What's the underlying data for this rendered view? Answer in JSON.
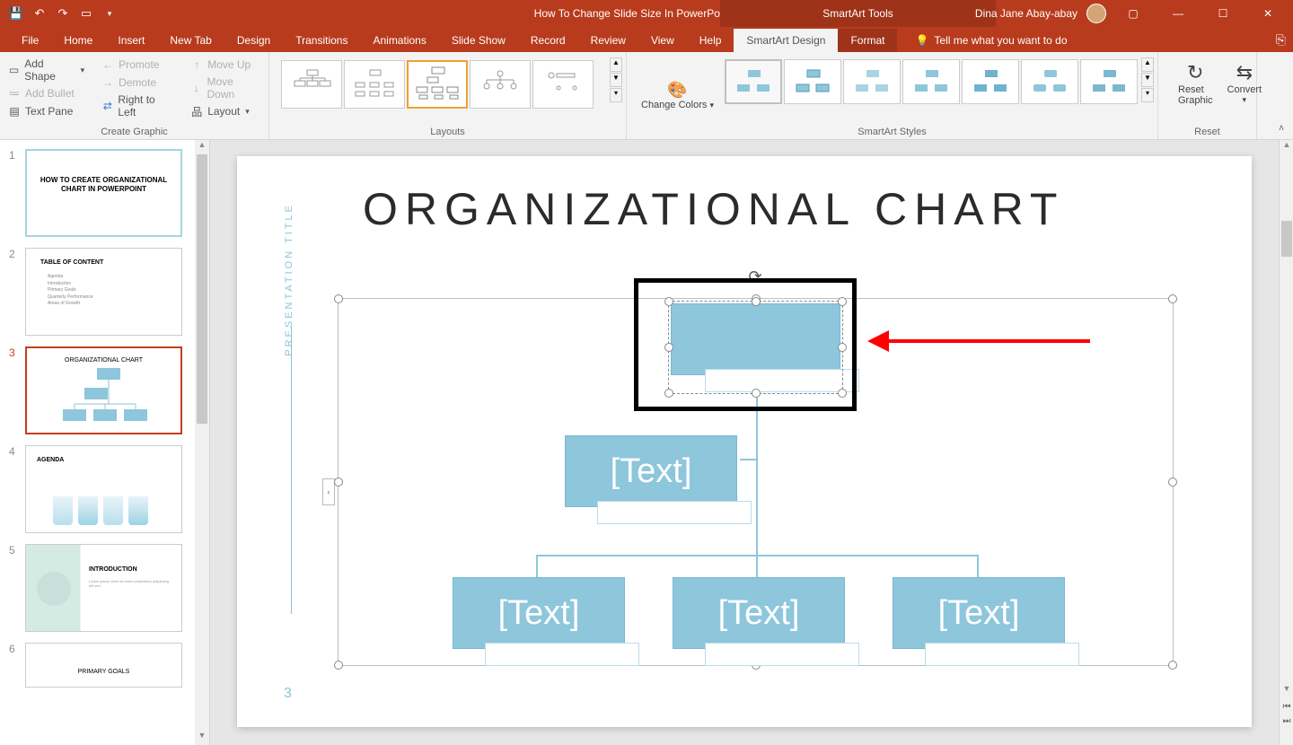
{
  "titlebar": {
    "doc_title": "How To Change Slide Size In PowerPoint.pptx [Autosaved]  -  PowerPoint",
    "tools_label": "SmartArt Tools",
    "user_name": "Dina Jane Abay-abay"
  },
  "tabs": {
    "file": "File",
    "home": "Home",
    "insert": "Insert",
    "newtab": "New Tab",
    "design": "Design",
    "transitions": "Transitions",
    "animations": "Animations",
    "slideshow": "Slide Show",
    "record": "Record",
    "review": "Review",
    "view": "View",
    "help": "Help",
    "smartart_design": "SmartArt Design",
    "format": "Format",
    "tell_me": "Tell me what you want to do"
  },
  "ribbon": {
    "create_graphic": {
      "add_shape": "Add Shape",
      "add_bullet": "Add Bullet",
      "text_pane": "Text Pane",
      "promote": "Promote",
      "demote": "Demote",
      "right_to_left": "Right to Left",
      "move_up": "Move Up",
      "move_down": "Move Down",
      "layout": "Layout",
      "group_label": "Create Graphic"
    },
    "layouts_label": "Layouts",
    "change_colors": "Change Colors",
    "styles_label": "SmartArt Styles",
    "reset_graphic": "Reset Graphic",
    "convert": "Convert",
    "reset_label": "Reset"
  },
  "thumbnails": [
    {
      "num": "1",
      "title": "HOW TO CREATE ORGANIZATIONAL CHART IN POWERPOINT"
    },
    {
      "num": "2",
      "title": "TABLE OF CONTENT",
      "items": [
        "Agenda",
        "Introduction",
        "Primary Goals",
        "Quarterly Performance",
        "Areas of Growth"
      ]
    },
    {
      "num": "3",
      "title": "ORGANIZATIONAL CHART"
    },
    {
      "num": "4",
      "title": "AGENDA"
    },
    {
      "num": "5",
      "title": "INTRODUCTION"
    },
    {
      "num": "6",
      "title": "PRIMARY GOALS"
    }
  ],
  "slide": {
    "sidebar_text": "PRESENTATION TITLE",
    "page_num": "3",
    "heading": "ORGANIZATIONAL CHART",
    "box_text": "[Text]"
  }
}
